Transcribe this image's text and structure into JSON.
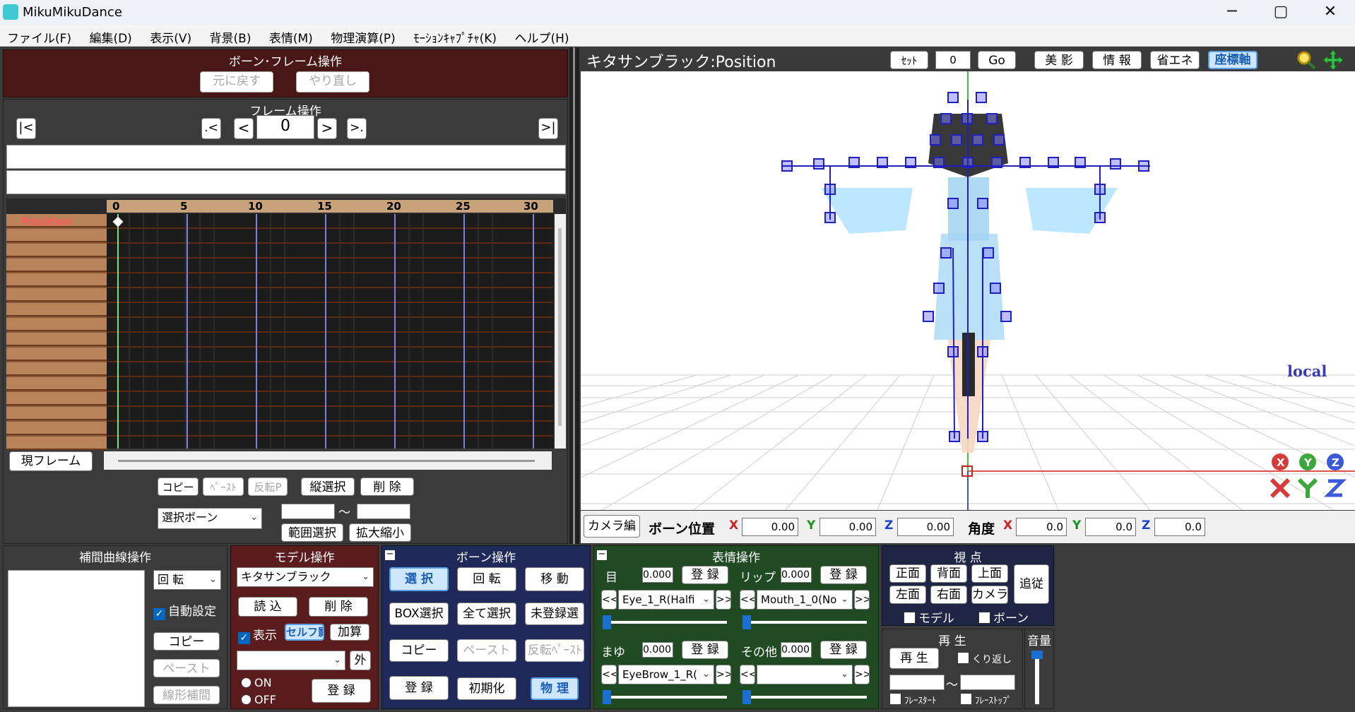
{
  "window": {
    "title": "MikuMikuDance",
    "controls": [
      "─",
      "▢",
      "✕"
    ]
  },
  "menu": [
    "ファイル(F)",
    "編集(D)",
    "表示(V)",
    "背景(B)",
    "表情(M)",
    "物理演算(P)",
    "ﾓｰｼｮﾝｷｬﾌﾟﾁｬ(K)",
    "ヘルプ(H)"
  ],
  "bone_frame_panel": {
    "title": "ボーン･フレーム操作",
    "undo": "元に戻す",
    "redo": "やり直し"
  },
  "frame_panel": {
    "title": "フレーム操作",
    "first": "|<",
    "prev_key": ".<",
    "prev": "<",
    "frame_value": "0",
    "next": ">",
    "next_key": ">.",
    "last": ">|"
  },
  "timeline": {
    "track_label": "Position",
    "ticks": [
      "0",
      "5",
      "10",
      "15",
      "20",
      "25",
      "30"
    ],
    "current_frame_button": "現フレーム",
    "copy": "コピー",
    "paste": "ﾍﾟｰｽﾄ",
    "flip_paste": "反転P",
    "vertical_select": "縦選択",
    "delete": "削 除",
    "selection_mode": "選択ボーン",
    "range_sep": "～",
    "range_select": "範囲選択",
    "scale": "拡大縮小"
  },
  "viewport": {
    "header_title": "キタサンブラック:Position",
    "set": "ｾｯﾄ",
    "frame_input": "0",
    "go": "Go",
    "shadow": "美 影",
    "info": "情 報",
    "eco": "省エネ",
    "axis": "座標軸",
    "local_label": "local",
    "axis_labels": [
      "X",
      "Y",
      "Z"
    ]
  },
  "bone_position_bar": {
    "camera_edit": "カメラ編",
    "pos_label": "ボーン位置",
    "pos": {
      "x": "0.00",
      "y": "0.00",
      "z": "0.00"
    },
    "ang_label": "角度",
    "ang": {
      "x": "0.0",
      "y": "0.0",
      "z": "0.0"
    },
    "axis_letters": [
      "X",
      "Y",
      "Z"
    ]
  },
  "interp_panel": {
    "title": "補間曲線操作",
    "mode": "回 転",
    "auto_label": "自動設定",
    "copy": "コピー",
    "paste": "ペースト",
    "linear": "線形補間"
  },
  "model_panel": {
    "title": "モデル操作",
    "model": "キタサンブラック",
    "load": "読 込",
    "delete": "削 除",
    "display": "表示",
    "self_shadow": "セルフ影",
    "add": "加算",
    "outside_select": "",
    "outside_btn": "外",
    "on": "ON",
    "off": "OFF",
    "register": "登 録"
  },
  "bone_panel": {
    "title": "ボーン操作",
    "select": "選 択",
    "rotate": "回 転",
    "move": "移 動",
    "box_select": "BOX選択",
    "all_select": "全て選択",
    "unregistered": "未登録選",
    "copy": "コピー",
    "paste": "ペースト",
    "flip_paste": "反転ﾍﾟｰｽﾄ",
    "register": "登 録",
    "init": "初期化",
    "physics": "物 理"
  },
  "face_panel": {
    "title": "表情操作",
    "eye_label": "目",
    "eye_value": "0.000",
    "lip_label": "リップ",
    "lip_value": "0.000",
    "brow_label": "まゆ",
    "brow_value": "0.000",
    "other_label": "その他",
    "other_value": "0.000",
    "register": "登 録",
    "eye_morph": "Eye_1_R(Halfi",
    "lip_morph": "Mouth_1_0(No",
    "brow_morph": "EyeBrow_1_R(",
    "other_morph": "",
    "prev": "<<",
    "next": ">>"
  },
  "view_panel": {
    "title": "視 点",
    "front": "正面",
    "back": "背面",
    "top": "上面",
    "left": "左面",
    "right": "右面",
    "camera": "カメラ",
    "follow": "追従",
    "model_chk": "モデル",
    "bone_chk": "ボーン"
  },
  "play_panel": {
    "title": "再 生",
    "play": "再 生",
    "repeat": "くり返し",
    "range_sep": "～",
    "start": "ﾌﾚｰｽﾀｰﾄ",
    "stop": "ﾌﾚｰｽﾄｯﾌﾟ"
  },
  "volume_panel": {
    "title": "音量"
  },
  "colors": {
    "panel_bg": "#3b3b3b",
    "dark_red": "#4a1717",
    "model_red": "#5a1c1c",
    "bone_blue": "#1f2a5a",
    "face_green": "#1f4a22",
    "view_navy": "#1f2545",
    "accent_blue": "#1a5fb4",
    "track_brown": "#b8825a"
  }
}
